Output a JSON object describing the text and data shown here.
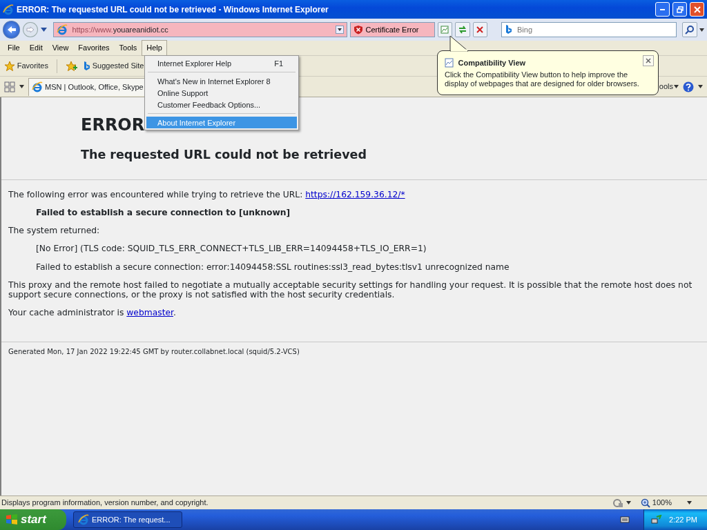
{
  "window": {
    "title": "ERROR: The requested URL could not be retrieved - Windows Internet Explorer"
  },
  "address_bar": {
    "prefix": "https://www.",
    "host": "youareanidiot.cc",
    "certificate_error": "Certificate Error"
  },
  "search": {
    "placeholder": "Bing"
  },
  "menu_bar": [
    {
      "label": "File",
      "selected": false
    },
    {
      "label": "Edit",
      "selected": false
    },
    {
      "label": "View",
      "selected": false
    },
    {
      "label": "Favorites",
      "selected": false
    },
    {
      "label": "Tools",
      "selected": false
    },
    {
      "label": "Help",
      "selected": true
    }
  ],
  "help_menu": [
    {
      "kind": "item",
      "label": "Internet Explorer Help",
      "shortcut": "F1",
      "selected": false
    },
    {
      "kind": "separator"
    },
    {
      "kind": "item",
      "label": "What's New in Internet Explorer 8",
      "selected": false
    },
    {
      "kind": "item",
      "label": "Online Support",
      "selected": false
    },
    {
      "kind": "item",
      "label": "Customer Feedback Options...",
      "selected": false
    },
    {
      "kind": "separator"
    },
    {
      "kind": "item",
      "label": "About Internet Explorer",
      "selected": true
    }
  ],
  "favorites_bar": {
    "favorites": "Favorites",
    "suggested": "Suggested Site"
  },
  "tab": {
    "label": "MSN | Outlook, Office, Skype"
  },
  "command_bar": {
    "tools": "ools"
  },
  "balloon": {
    "title": "Compatibility View",
    "text": "Click the Compatibility View button to help improve the display of webpages that are designed for older browsers."
  },
  "page": {
    "heading": "ERROR",
    "subheading": "The requested URL could not be retrieved",
    "blocks": [
      {
        "kind": "text",
        "text": "The following error was encountered while trying to retrieve the URL: ",
        "link": "https://162.159.36.12/*"
      },
      {
        "kind": "indent-bold",
        "text": "Failed to establish a secure connection to [unknown]"
      },
      {
        "kind": "text",
        "text": "The system returned:"
      },
      {
        "kind": "indent",
        "text": "[No Error] (TLS code: SQUID_TLS_ERR_CONNECT+TLS_LIB_ERR=14094458+TLS_IO_ERR=1)"
      },
      {
        "kind": "indent",
        "text": "Failed to establish a secure connection: error:14094458:SSL routines:ssl3_read_bytes:tlsv1 unrecognized name"
      },
      {
        "kind": "text",
        "text": "This proxy and the remote host failed to negotiate a mutually acceptable security settings for handling your request. It is possible that the remote host does not support secure connections, or the proxy is not satisfied with the host security credentials."
      },
      {
        "kind": "text",
        "text": "Your cache administrator is ",
        "link": "webmaster",
        "after": "."
      }
    ],
    "footer": "Generated Mon, 17 Jan 2022 19:22:45 GMT by router.collabnet.local (squid/5.2-VCS)"
  },
  "status_bar": {
    "text": "Displays program information, version number, and copyright.",
    "zoom": "100%"
  },
  "taskbar": {
    "start": "start",
    "task": "ERROR: The request...",
    "clock": "2:22 PM"
  }
}
